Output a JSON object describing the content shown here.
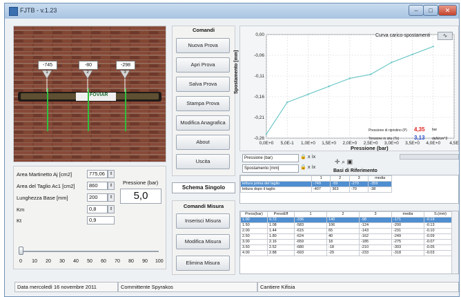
{
  "window": {
    "title": "FJTB - v.1.23",
    "min": "–",
    "max": "□",
    "close": "✕"
  },
  "photo": {
    "gauges": [
      {
        "value": "-745",
        "index": "1"
      },
      {
        "value": "-80",
        "index": "2"
      },
      {
        "value": "-298",
        "index": "3"
      }
    ],
    "logo": "FOVIAR"
  },
  "inputs": {
    "area_martinetto": {
      "label": "Area Martinetto Aj [cm2]",
      "value": "775,06"
    },
    "area_taglio": {
      "label": "Area del Taglio Ac1 [cm2]",
      "value": "860"
    },
    "lunghezza": {
      "label": "Lunghezza Base [mm]",
      "value": "200"
    },
    "km": {
      "label": "Km",
      "value": "0,8"
    },
    "kt": {
      "label": "Kt",
      "value": "0,9"
    },
    "pressione_label": "Pressione (bar)",
    "pressione_value": "5,0"
  },
  "slider": {
    "value": 0,
    "ticks": [
      "0",
      "10",
      "20",
      "30",
      "40",
      "50",
      "60",
      "70",
      "80",
      "90",
      "100"
    ]
  },
  "comandi": {
    "title": "Comandi",
    "buttons": [
      "Nuova Prova",
      "Apri Prova",
      "Salva Prova",
      "Stampa Prova",
      "Modifica Anagrafica",
      "About",
      "Uscita"
    ]
  },
  "schema_singolo": "Schema Singolo",
  "comandi_misura": {
    "title": "Comandi Misura",
    "buttons": [
      "Inserisci Misura",
      "Modifica Misura",
      "Elimina Misura"
    ]
  },
  "chart_data": {
    "type": "line",
    "title": "Curva carico-spostamenti",
    "xlabel": "Pressione (bar)",
    "ylabel": "Spostamento [mm]",
    "xlim": [
      0,
      4.5
    ],
    "ylim": [
      -0.26,
      0.0
    ],
    "xticks": [
      "0,0E+0",
      "5,0E-1",
      "1,0E+0",
      "1,5E+0",
      "2,0E+0",
      "2,5E+0",
      "3,0E+0",
      "3,5E+0",
      "4,0E+0",
      "4,5E"
    ],
    "yticks": [
      "0,00",
      "-0,06",
      "-0,11",
      "-0,16",
      "-0,21",
      "-0,26"
    ],
    "series": [
      {
        "x": [
          0.0,
          0.5,
          1.0,
          1.5,
          2.0,
          2.5,
          3.0,
          3.5,
          4.0
        ],
        "y": [
          -0.25,
          -0.17,
          -0.15,
          -0.13,
          -0.11,
          -0.1,
          -0.07,
          -0.05,
          -0.03
        ]
      }
    ],
    "color": "#6cc7c7",
    "grid": true
  },
  "chart_info": {
    "pressione_label": "Pressione di ripristino (P)",
    "pressione_value": "4,35",
    "pressione_unit": "bar",
    "tensione_label": "Tensione in situ (Ts)",
    "tensione_value": "3,13",
    "tensione_unit": "daN/cm^2"
  },
  "axis_selectors": [
    {
      "label": "Pressione (bar)"
    },
    {
      "label": "Spostamento [mm]"
    }
  ],
  "basi": {
    "title": "Basi di Riferimento",
    "headers": [
      "",
      "1",
      "2",
      "3",
      "media"
    ],
    "rows": [
      [
        "lettura prima del taglio",
        "-749",
        "-59",
        "-270",
        "-359"
      ],
      [
        "lettura dopo il taglio",
        "-407",
        "363",
        "-70",
        "-38"
      ]
    ]
  },
  "misure": {
    "headers": [
      "Press(bar)",
      "PressEff",
      "1",
      "2",
      "3",
      "media",
      "S.(mm)"
    ],
    "rows": [
      [
        "1.00",
        "0.72",
        "-336",
        "140",
        "-98",
        "-171",
        "-0.19"
      ],
      [
        "1.50",
        "1.08",
        "-583",
        "106",
        "-124",
        "-200",
        "-0.13"
      ],
      [
        "2.00",
        "1.44",
        "-615",
        "65",
        "-143",
        "-231",
        "-0.10"
      ],
      [
        "2.50",
        "1.80",
        "-624",
        "40",
        "-162",
        "-249",
        "-0.09"
      ],
      [
        "3.00",
        "2.16",
        "-659",
        "18",
        "-185",
        "-275",
        "-0.07"
      ],
      [
        "3.50",
        "2.52",
        "-680",
        "-18",
        "-210",
        "-303",
        "-0.05"
      ],
      [
        "4.00",
        "2.88",
        "-693",
        "-29",
        "-233",
        "-318",
        "-0.03"
      ]
    ]
  },
  "status": {
    "data_label": "Data",
    "data_value": "mercoledì 16 novembre 2011",
    "committente_label": "Committente",
    "committente_value": "Spyrakos",
    "cantiere_label": "Cantiere",
    "cantiere_value": "Kifisia"
  }
}
